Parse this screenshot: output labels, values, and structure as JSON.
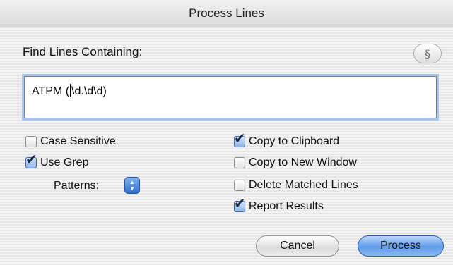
{
  "window": {
    "title": "Process Lines"
  },
  "find": {
    "label": "Find Lines Containing:",
    "special_button": "§",
    "value_before_caret": "ATPM (",
    "value_after_caret": "\\d.\\d\\d)"
  },
  "options_left": [
    {
      "label": "Case Sensitive",
      "checked": false
    },
    {
      "label": "Use Grep",
      "checked": true
    }
  ],
  "patterns": {
    "label": "Patterns:",
    "popup_icon": "up-down-arrows-icon"
  },
  "options_right": [
    {
      "label": "Copy to Clipboard",
      "checked": true
    },
    {
      "label": "Copy to New Window",
      "checked": false
    },
    {
      "label": "Delete Matched Lines",
      "checked": false
    },
    {
      "label": "Report Results",
      "checked": true
    }
  ],
  "buttons": {
    "cancel": "Cancel",
    "process": "Process"
  },
  "colors": {
    "accent": "#4a86e0",
    "check": "#15284d",
    "focus_ring": "#a9c7ee"
  },
  "glyphs": {
    "check": "✔",
    "arrow_up": "▲",
    "arrow_down": "▼"
  }
}
